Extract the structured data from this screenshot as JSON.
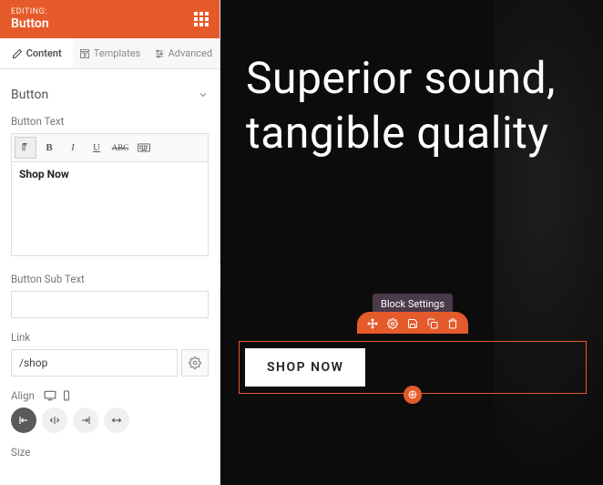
{
  "header": {
    "sub": "EDITING:",
    "title": "Button"
  },
  "tabs": [
    {
      "label": "Content",
      "active": true
    },
    {
      "label": "Templates",
      "active": false
    },
    {
      "label": "Advanced",
      "active": false
    }
  ],
  "section": {
    "title": "Button"
  },
  "fields": {
    "button_text": {
      "label": "Button Text",
      "value": "Shop Now"
    },
    "sub_text": {
      "label": "Button Sub Text",
      "value": ""
    },
    "link": {
      "label": "Link",
      "value": "/shop"
    },
    "align": {
      "label": "Align"
    },
    "size": {
      "label": "Size"
    }
  },
  "preview": {
    "hero": "Superior sound, tangible quality",
    "tooltip": "Block Settings",
    "button_label": "SHOP NOW"
  }
}
